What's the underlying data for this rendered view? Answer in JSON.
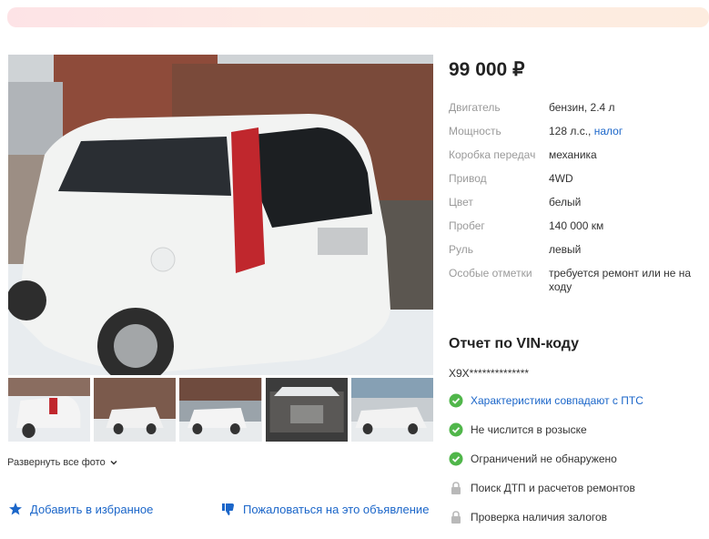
{
  "listing": {
    "price": "99 000 ₽",
    "specs": [
      {
        "label": "Двигатель",
        "value": "бензин, 2.4 л",
        "link": ""
      },
      {
        "label": "Мощность",
        "value": "128 л.с.,",
        "link": "налог"
      },
      {
        "label": "Коробка передач",
        "value": "механика",
        "link": ""
      },
      {
        "label": "Привод",
        "value": "4WD",
        "link": ""
      },
      {
        "label": "Цвет",
        "value": "белый",
        "link": ""
      },
      {
        "label": "Пробег",
        "value": "140 000 км",
        "link": ""
      },
      {
        "label": "Руль",
        "value": "левый",
        "link": ""
      },
      {
        "label": "Особые отметки",
        "value": "требуется ремонт или не на ходу",
        "link": ""
      }
    ]
  },
  "gallery": {
    "expand_label": "Развернуть все фото"
  },
  "actions": {
    "favorite_label": "Добавить в избранное",
    "report_label": "Пожаловаться на это объявление"
  },
  "vin_report": {
    "title": "Отчет по VIN-коду",
    "vin": "X9X**************",
    "items": [
      {
        "text": "Характеристики совпадают с ПТС",
        "status": "ok",
        "link": true
      },
      {
        "text": "Не числится в розыске",
        "status": "ok",
        "link": false
      },
      {
        "text": "Ограничений не обнаружено",
        "status": "ok",
        "link": false
      },
      {
        "text": "Поиск ДТП и расчетов ремонтов",
        "status": "locked",
        "link": false
      },
      {
        "text": "Проверка наличия залогов",
        "status": "locked",
        "link": false
      }
    ]
  },
  "colors": {
    "accent": "#1b66c9",
    "ok_green": "#50b64a",
    "lock_gray": "#b9b9b9"
  }
}
